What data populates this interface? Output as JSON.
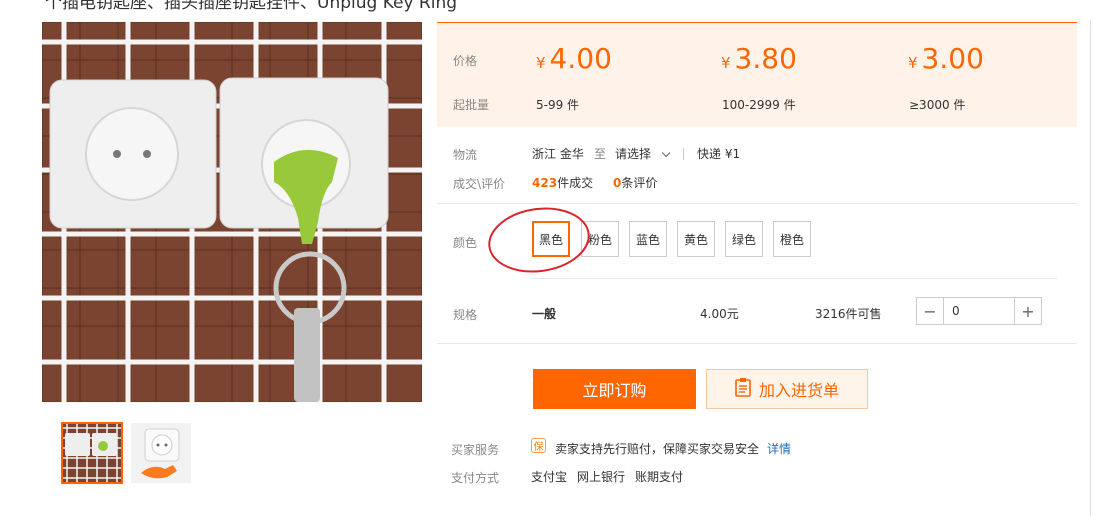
{
  "product": {
    "title_partial": "个插电钥匙座、插头插座钥匙挂件、Unplug Key Ring"
  },
  "prices": {
    "price_label": "价格",
    "moq_label": "起批量",
    "currency": "¥",
    "tiers": [
      {
        "price": "4.00",
        "range": "5-99 件"
      },
      {
        "price": "3.80",
        "range": "100-2999 件"
      },
      {
        "price": "3.00",
        "range": "≥3000 件"
      }
    ]
  },
  "logistics": {
    "label": "物流",
    "origin": "浙江 金华",
    "to": "至",
    "dest_select": "请选择",
    "shipping": "快递 ¥1"
  },
  "deals": {
    "label": "成交\\评价",
    "deal_count": "423",
    "deal_suffix": "件成交",
    "review_count": "0",
    "review_suffix": "条评价"
  },
  "color": {
    "label": "颜色",
    "options": [
      "黑色",
      "粉色",
      "蓝色",
      "黄色",
      "绿色",
      "橙色"
    ],
    "selected": "黑色"
  },
  "spec": {
    "label": "规格",
    "name": "一般",
    "price": "4.00元",
    "stock": "3216件可售",
    "quantity": "0",
    "minus": "−",
    "plus": "+"
  },
  "actions": {
    "order": "立即订购",
    "cart": "加入进货单"
  },
  "service": {
    "label": "买家服务",
    "badge": "保",
    "text": "卖家支持先行赔付，保障买家交易安全",
    "detail_link": "详情"
  },
  "payment": {
    "label": "支付方式",
    "methods": [
      "支付宝",
      "网上银行",
      "账期支付"
    ]
  },
  "colors": {
    "accent": "#ff6600",
    "price_bg": "#fff2e8",
    "annotation": "#d9252e"
  }
}
